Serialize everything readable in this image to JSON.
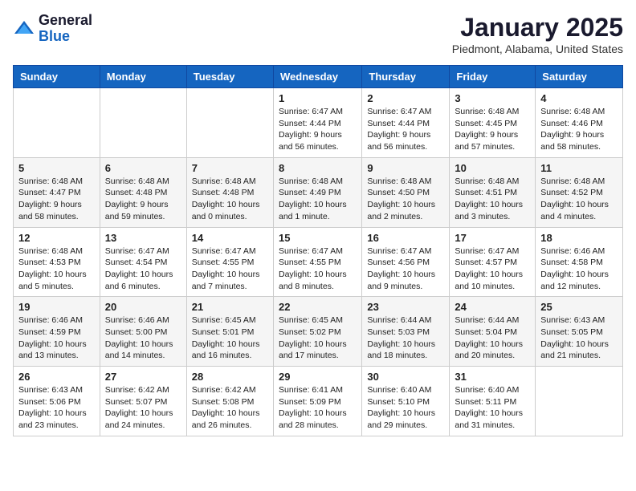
{
  "header": {
    "logo_general": "General",
    "logo_blue": "Blue",
    "month": "January 2025",
    "location": "Piedmont, Alabama, United States"
  },
  "weekdays": [
    "Sunday",
    "Monday",
    "Tuesday",
    "Wednesday",
    "Thursday",
    "Friday",
    "Saturday"
  ],
  "weeks": [
    [
      null,
      null,
      null,
      {
        "day": "1",
        "sunrise": "6:47 AM",
        "sunset": "4:44 PM",
        "daylight": "9 hours and 56 minutes."
      },
      {
        "day": "2",
        "sunrise": "6:47 AM",
        "sunset": "4:44 PM",
        "daylight": "9 hours and 56 minutes."
      },
      {
        "day": "3",
        "sunrise": "6:48 AM",
        "sunset": "4:45 PM",
        "daylight": "9 hours and 57 minutes."
      },
      {
        "day": "4",
        "sunrise": "6:48 AM",
        "sunset": "4:46 PM",
        "daylight": "9 hours and 58 minutes."
      }
    ],
    [
      {
        "day": "5",
        "sunrise": "6:48 AM",
        "sunset": "4:47 PM",
        "daylight": "9 hours and 58 minutes."
      },
      {
        "day": "6",
        "sunrise": "6:48 AM",
        "sunset": "4:48 PM",
        "daylight": "9 hours and 59 minutes."
      },
      {
        "day": "7",
        "sunrise": "6:48 AM",
        "sunset": "4:48 PM",
        "daylight": "10 hours and 0 minutes."
      },
      {
        "day": "8",
        "sunrise": "6:48 AM",
        "sunset": "4:49 PM",
        "daylight": "10 hours and 1 minute."
      },
      {
        "day": "9",
        "sunrise": "6:48 AM",
        "sunset": "4:50 PM",
        "daylight": "10 hours and 2 minutes."
      },
      {
        "day": "10",
        "sunrise": "6:48 AM",
        "sunset": "4:51 PM",
        "daylight": "10 hours and 3 minutes."
      },
      {
        "day": "11",
        "sunrise": "6:48 AM",
        "sunset": "4:52 PM",
        "daylight": "10 hours and 4 minutes."
      }
    ],
    [
      {
        "day": "12",
        "sunrise": "6:48 AM",
        "sunset": "4:53 PM",
        "daylight": "10 hours and 5 minutes."
      },
      {
        "day": "13",
        "sunrise": "6:47 AM",
        "sunset": "4:54 PM",
        "daylight": "10 hours and 6 minutes."
      },
      {
        "day": "14",
        "sunrise": "6:47 AM",
        "sunset": "4:55 PM",
        "daylight": "10 hours and 7 minutes."
      },
      {
        "day": "15",
        "sunrise": "6:47 AM",
        "sunset": "4:55 PM",
        "daylight": "10 hours and 8 minutes."
      },
      {
        "day": "16",
        "sunrise": "6:47 AM",
        "sunset": "4:56 PM",
        "daylight": "10 hours and 9 minutes."
      },
      {
        "day": "17",
        "sunrise": "6:47 AM",
        "sunset": "4:57 PM",
        "daylight": "10 hours and 10 minutes."
      },
      {
        "day": "18",
        "sunrise": "6:46 AM",
        "sunset": "4:58 PM",
        "daylight": "10 hours and 12 minutes."
      }
    ],
    [
      {
        "day": "19",
        "sunrise": "6:46 AM",
        "sunset": "4:59 PM",
        "daylight": "10 hours and 13 minutes."
      },
      {
        "day": "20",
        "sunrise": "6:46 AM",
        "sunset": "5:00 PM",
        "daylight": "10 hours and 14 minutes."
      },
      {
        "day": "21",
        "sunrise": "6:45 AM",
        "sunset": "5:01 PM",
        "daylight": "10 hours and 16 minutes."
      },
      {
        "day": "22",
        "sunrise": "6:45 AM",
        "sunset": "5:02 PM",
        "daylight": "10 hours and 17 minutes."
      },
      {
        "day": "23",
        "sunrise": "6:44 AM",
        "sunset": "5:03 PM",
        "daylight": "10 hours and 18 minutes."
      },
      {
        "day": "24",
        "sunrise": "6:44 AM",
        "sunset": "5:04 PM",
        "daylight": "10 hours and 20 minutes."
      },
      {
        "day": "25",
        "sunrise": "6:43 AM",
        "sunset": "5:05 PM",
        "daylight": "10 hours and 21 minutes."
      }
    ],
    [
      {
        "day": "26",
        "sunrise": "6:43 AM",
        "sunset": "5:06 PM",
        "daylight": "10 hours and 23 minutes."
      },
      {
        "day": "27",
        "sunrise": "6:42 AM",
        "sunset": "5:07 PM",
        "daylight": "10 hours and 24 minutes."
      },
      {
        "day": "28",
        "sunrise": "6:42 AM",
        "sunset": "5:08 PM",
        "daylight": "10 hours and 26 minutes."
      },
      {
        "day": "29",
        "sunrise": "6:41 AM",
        "sunset": "5:09 PM",
        "daylight": "10 hours and 28 minutes."
      },
      {
        "day": "30",
        "sunrise": "6:40 AM",
        "sunset": "5:10 PM",
        "daylight": "10 hours and 29 minutes."
      },
      {
        "day": "31",
        "sunrise": "6:40 AM",
        "sunset": "5:11 PM",
        "daylight": "10 hours and 31 minutes."
      },
      null
    ]
  ]
}
